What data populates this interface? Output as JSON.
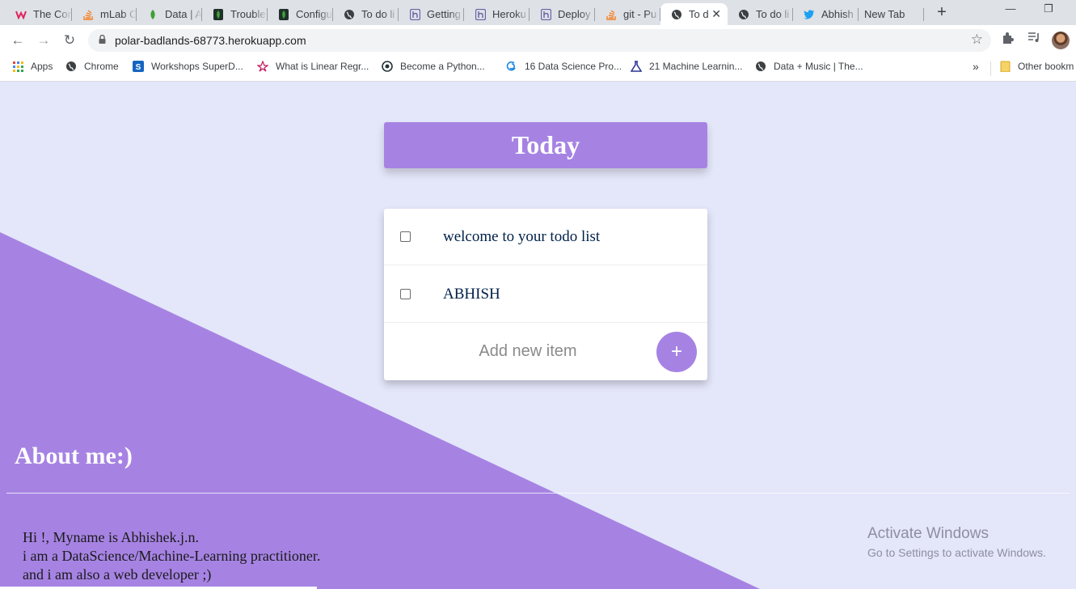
{
  "browser": {
    "tabs": [
      {
        "title": "The Cor",
        "icon": "w-logo-icon",
        "color": "#e0245e"
      },
      {
        "title": "mLab C",
        "icon": "stack-icon",
        "color": "#f48024"
      },
      {
        "title": "Data | A",
        "icon": "leaf-icon",
        "color": "#3fa037"
      },
      {
        "title": "Trouble",
        "icon": "leaf-icon",
        "color": "#3fa037"
      },
      {
        "title": "Configu",
        "icon": "leaf-icon",
        "color": "#3fa037"
      },
      {
        "title": "To do li",
        "icon": "globe-icon",
        "color": "#3c4043"
      },
      {
        "title": "Getting",
        "icon": "heroku-icon",
        "color": "#6762a6"
      },
      {
        "title": "Heroku",
        "icon": "heroku-icon",
        "color": "#6762a6"
      },
      {
        "title": "Deploy",
        "icon": "heroku-icon",
        "color": "#6762a6"
      },
      {
        "title": "git - Pu",
        "icon": "stack-icon",
        "color": "#f48024"
      },
      {
        "title": "To d",
        "icon": "globe-icon",
        "color": "#3c4043",
        "active": true
      },
      {
        "title": "To do li",
        "icon": "globe-icon",
        "color": "#3c4043"
      },
      {
        "title": "Abhish",
        "icon": "twitter-icon",
        "color": "#1da1f2"
      },
      {
        "title": "New Tab",
        "icon": "",
        "color": ""
      }
    ],
    "address": "polar-badlands-68773.herokuapp.com",
    "bookmarks": [
      {
        "label": "Apps",
        "icon": "apps-grid-icon"
      },
      {
        "label": "Chrome",
        "icon": "globe-icon"
      },
      {
        "label": "Workshops SuperD...",
        "icon": "s-logo-icon"
      },
      {
        "label": "What is Linear Regr...",
        "icon": "star-logo-icon"
      },
      {
        "label": "Become a Python...",
        "icon": "python-logo-icon"
      },
      {
        "label": "16 Data Science Pro...",
        "icon": "swirl-logo-icon"
      },
      {
        "label": "21 Machine Learnin...",
        "icon": "flask-logo-icon"
      },
      {
        "label": "Data + Music | The...",
        "icon": "globe-icon"
      }
    ],
    "other_bookmarks": "Other bookm"
  },
  "app": {
    "heading": "Today",
    "items": [
      {
        "text": "welcome to your todo list",
        "checked": false
      },
      {
        "text": "ABHISH",
        "checked": false
      }
    ],
    "new_item_placeholder": "Add new item",
    "add_button": "+",
    "accent": "#a683e3",
    "background": "#e4e6fa"
  },
  "about": {
    "title": "About me:)",
    "lines": [
      "Hi !, Myname is Abhishek.j.n.",
      "i am a DataScience/Machine-Learning practitioner.",
      "and i am also a web developer ;)"
    ]
  },
  "watermark": {
    "line1": "Activate Windows",
    "line2": "Go to Settings to activate Windows."
  }
}
